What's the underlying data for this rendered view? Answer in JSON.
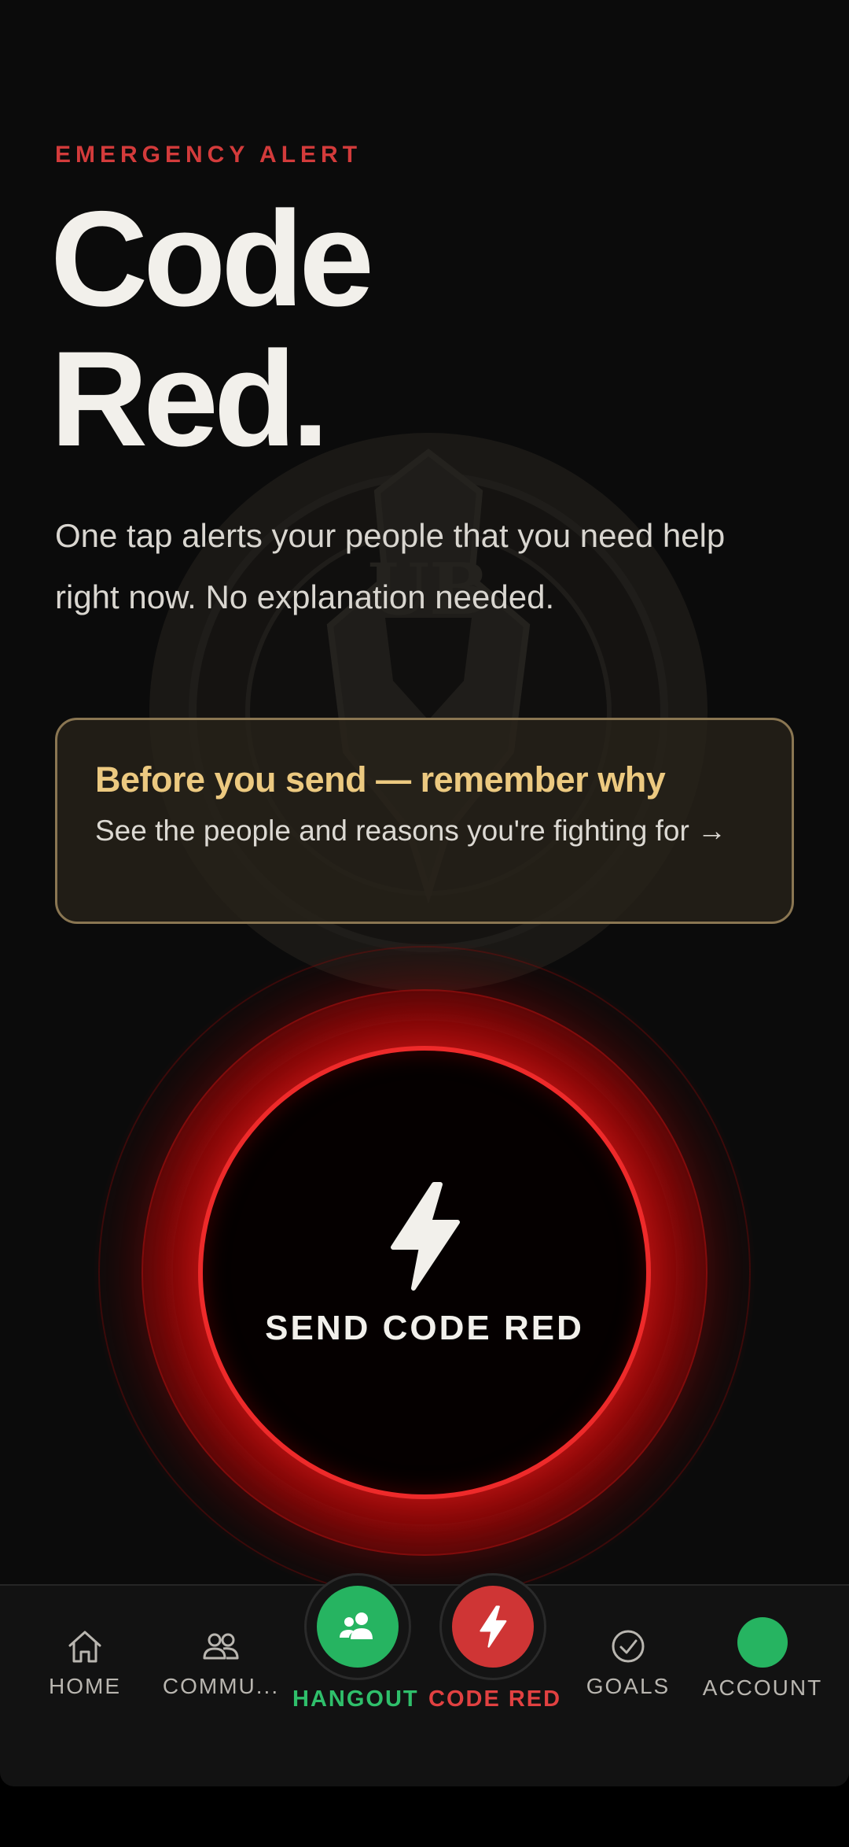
{
  "header": {
    "eyebrow": "EMERGENCY ALERT",
    "title_line1": "Code",
    "title_line2": "Red.",
    "description": "One tap alerts your people that you need help right now. No explanation needed."
  },
  "remember_card": {
    "title": "Before you send — remember why",
    "subtitle": "See the people and reasons you're fighting for →"
  },
  "send_button": {
    "label": "SEND CODE RED",
    "icon": "lightning-bolt-icon"
  },
  "tabbar": {
    "items": [
      {
        "label": "HOME",
        "icon": "home-icon"
      },
      {
        "label": "COMMU...",
        "icon": "community-icon"
      },
      {
        "label": "HANGOUT",
        "icon": "people-icon"
      },
      {
        "label": "CODE RED",
        "icon": "lightning-bolt-icon"
      },
      {
        "label": "GOALS",
        "icon": "check-circle-icon"
      },
      {
        "label": "ACCOUNT",
        "icon": "avatar"
      }
    ]
  },
  "colors": {
    "accent_red": "#ee2a2a",
    "eyebrow_red": "#d33b3b",
    "gold": "#ecc980",
    "green": "#26b461",
    "background": "#0b0b0b"
  }
}
